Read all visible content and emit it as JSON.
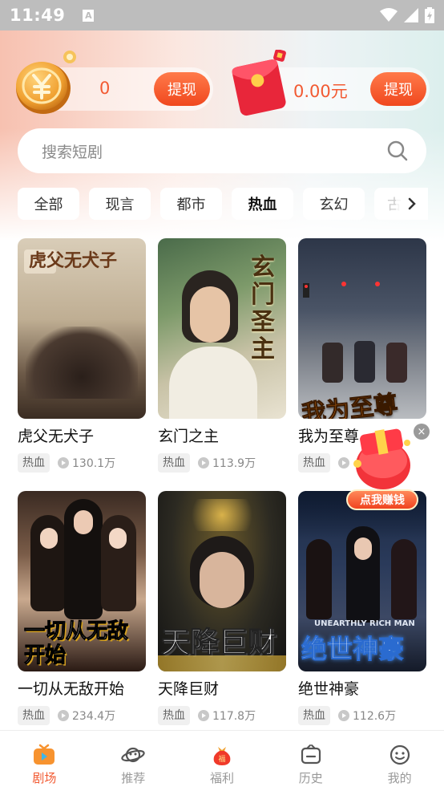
{
  "status_bar": {
    "time": "11:49",
    "notification_glyph": "A"
  },
  "wallet": {
    "coins": "0",
    "coins_withdraw": "提现",
    "cash": "0.00元",
    "cash_withdraw": "提现"
  },
  "search": {
    "placeholder": "搜索短剧"
  },
  "tabs": [
    {
      "label": "全部"
    },
    {
      "label": "现言"
    },
    {
      "label": "都市"
    },
    {
      "label": "热血",
      "active": true
    },
    {
      "label": "玄幻"
    },
    {
      "label": "古"
    }
  ],
  "dramas": [
    {
      "title": "虎父无犬子",
      "genre": "热血",
      "plays": "130.1万",
      "poster_text": "虎父无犬子"
    },
    {
      "title": "玄门之主",
      "genre": "热血",
      "plays": "113.9万",
      "poster_text": "玄门圣主"
    },
    {
      "title": "我为至尊",
      "genre": "热血",
      "plays": "",
      "poster_text": "我为至尊"
    },
    {
      "title": "一切从无敌开始",
      "genre": "热血",
      "plays": "234.4万",
      "poster_text": "一切从无敌开始"
    },
    {
      "title": "天降巨财",
      "genre": "热血",
      "plays": "117.8万",
      "poster_text": "天降巨财"
    },
    {
      "title": "绝世神豪",
      "genre": "热血",
      "plays": "112.6万",
      "poster_text": "绝世神豪",
      "poster_sub": "UNEARTHLY RICH MAN"
    }
  ],
  "promo": {
    "label": "点我赚钱",
    "close": "×",
    "badge": "福"
  },
  "bottom_nav": [
    {
      "label": "剧场",
      "icon": "tv-icon",
      "active": true
    },
    {
      "label": "推荐",
      "icon": "planet-icon"
    },
    {
      "label": "福利",
      "icon": "money-bag-icon",
      "badge": "福"
    },
    {
      "label": "历史",
      "icon": "history-icon"
    },
    {
      "label": "我的",
      "icon": "smiley-icon"
    }
  ],
  "colors": {
    "accent": "#f25a32",
    "button": "#f0481e"
  }
}
